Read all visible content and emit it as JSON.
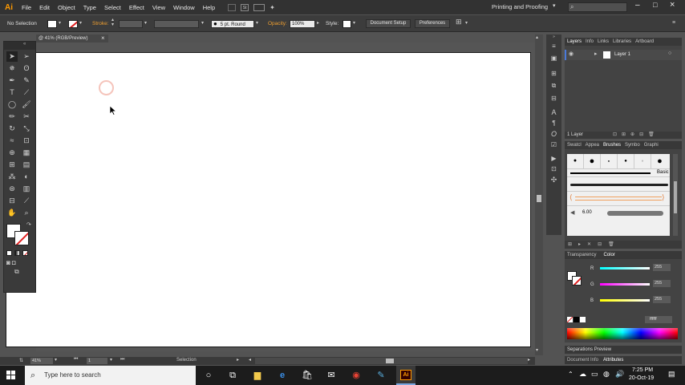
{
  "menubar": {
    "app_logo": "Ai",
    "items": [
      "File",
      "Edit",
      "Object",
      "Type",
      "Select",
      "Effect",
      "View",
      "Window",
      "Help"
    ],
    "workspace": "Printing and Proofing",
    "search_icon": "search-icon"
  },
  "control_bar": {
    "selection": "No Selection",
    "stroke_label": "Stroke:",
    "brush": "5 pt. Round",
    "opacity_label": "Opacity:",
    "opacity_value": "100%",
    "style_label": "Style:",
    "document_setup": "Document Setup",
    "preferences": "Preferences"
  },
  "document_tab": {
    "title": "@ 41% (RGB/Preview)",
    "close": "×"
  },
  "status_bar": {
    "zoom": "41%",
    "page": "1",
    "tool": "Selection"
  },
  "layers_panel": {
    "tabs": [
      "Layers",
      "Info",
      "Links",
      "Libraries",
      "Artboard"
    ],
    "layer_name": "Layer 1",
    "layer_count": "1 Layer"
  },
  "brushes_panel": {
    "tabs": [
      "Swatcl",
      "Appea",
      "Brushes",
      "Symbo",
      "Graphi"
    ],
    "basic_label": "Basic",
    "size_value": "6.00"
  },
  "color_panel": {
    "tabs": [
      "Transparency",
      "Color"
    ],
    "channels": [
      {
        "label": "R",
        "value": "255",
        "color": "#ff0000"
      },
      {
        "label": "G",
        "value": "255",
        "color": "#00ff00"
      },
      {
        "label": "B",
        "value": "255",
        "color": "#0000ff"
      }
    ],
    "hex": "ffffff"
  },
  "bottom_panels": {
    "separations": "Separations Preview",
    "document_info": "Document Info",
    "attributes": "Attributes"
  },
  "taskbar": {
    "search_placeholder": "Type here to search",
    "time": "7:25 PM",
    "date": "20-Oct-19"
  }
}
